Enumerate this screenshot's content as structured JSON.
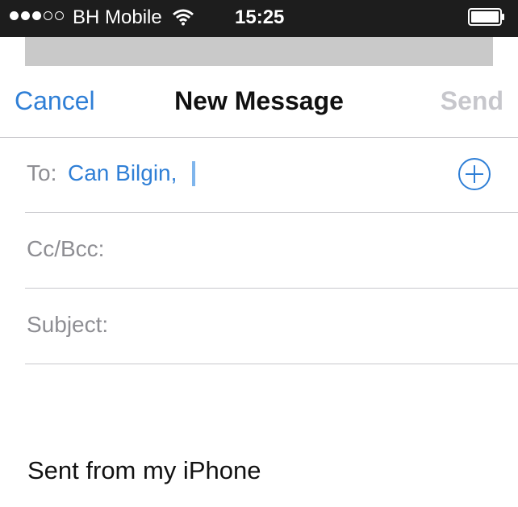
{
  "status_bar": {
    "signal_dots": [
      true,
      true,
      true,
      false,
      false
    ],
    "carrier": "BH Mobile",
    "time": "15:25",
    "icons": [
      "wifi-icon",
      "battery-icon"
    ]
  },
  "nav": {
    "cancel_label": "Cancel",
    "title": "New Message",
    "send_label": "Send"
  },
  "fields": {
    "to_label": "To:",
    "to_value": "Can Bilgin,",
    "cc_bcc_label": "Cc/Bcc:",
    "subject_label": "Subject:"
  },
  "body": {
    "signature": "Sent from my iPhone"
  },
  "colors": {
    "accent": "#2f7fd6",
    "disabled": "#c7c7cc",
    "placeholder": "#8e8e93",
    "status_bar_bg": "#1d1d1d",
    "separator": "#c8c7cc"
  }
}
